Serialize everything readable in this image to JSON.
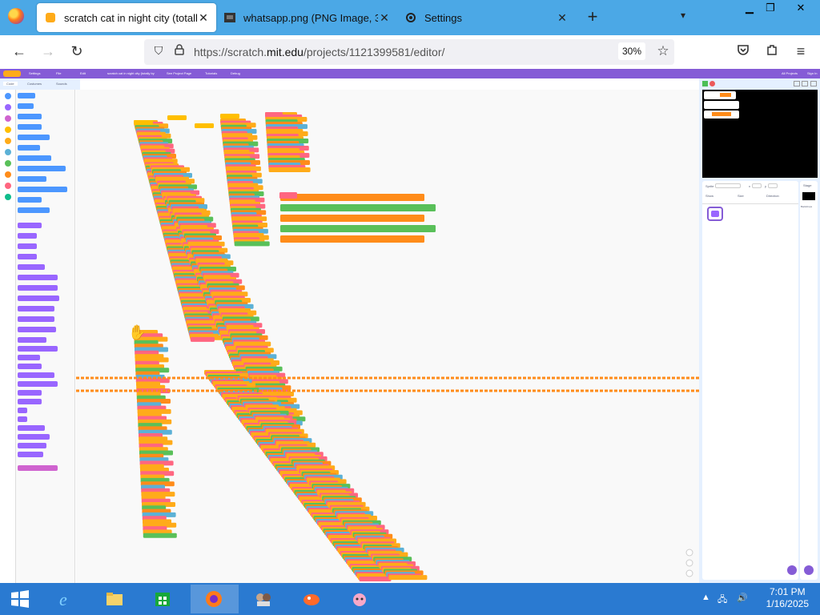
{
  "browser": {
    "tabs": [
      {
        "label": "scratch cat in night city (totally",
        "active": true
      },
      {
        "label": "whatsapp.png (PNG Image, 34",
        "active": false
      },
      {
        "label": "Settings",
        "active": false
      }
    ],
    "new_tab": "+",
    "url_prefix": "https://scratch.",
    "url_domain": "mit.edu",
    "url_path": "/projects/1121399581/editor/",
    "zoom": "30%"
  },
  "scratch": {
    "menu_items": [
      "Settings",
      "File",
      "Edit",
      "scratch cat in night city (totally by TRX-57)",
      "See Project Page",
      "Tutorials",
      "Debug"
    ],
    "menu_right": [
      "All Projects",
      "Sign In"
    ],
    "tabs": [
      "Code",
      "Costumes",
      "Sounds"
    ],
    "categories": [
      {
        "name": "Motion",
        "color": "#4c97ff"
      },
      {
        "name": "Looks",
        "color": "#9966ff"
      },
      {
        "name": "Sound",
        "color": "#cf63cf"
      },
      {
        "name": "Events",
        "color": "#ffbf00"
      },
      {
        "name": "Control",
        "color": "#ffab19"
      },
      {
        "name": "Sensing",
        "color": "#5cb1d6"
      },
      {
        "name": "Operators",
        "color": "#59c059"
      },
      {
        "name": "Variables",
        "color": "#ff8c1a"
      },
      {
        "name": "My Blocks",
        "color": "#ff6680"
      },
      {
        "name": "Pen",
        "color": "#0fbd8c"
      }
    ],
    "palette_sections": [
      "Motion",
      "Looks",
      "Sound"
    ],
    "sprite_labels": [
      "Sprite",
      "x",
      "y",
      "Show",
      "Size",
      "Direction"
    ],
    "stage_label": "Stage",
    "backdrops_label": "Backdrops"
  },
  "taskbar": {
    "apps": [
      "start",
      "internet-explorer",
      "file-explorer",
      "store",
      "firefox",
      "app-1",
      "app-2",
      "app-3"
    ],
    "time": "7:01 PM",
    "date": "1/16/2025"
  }
}
